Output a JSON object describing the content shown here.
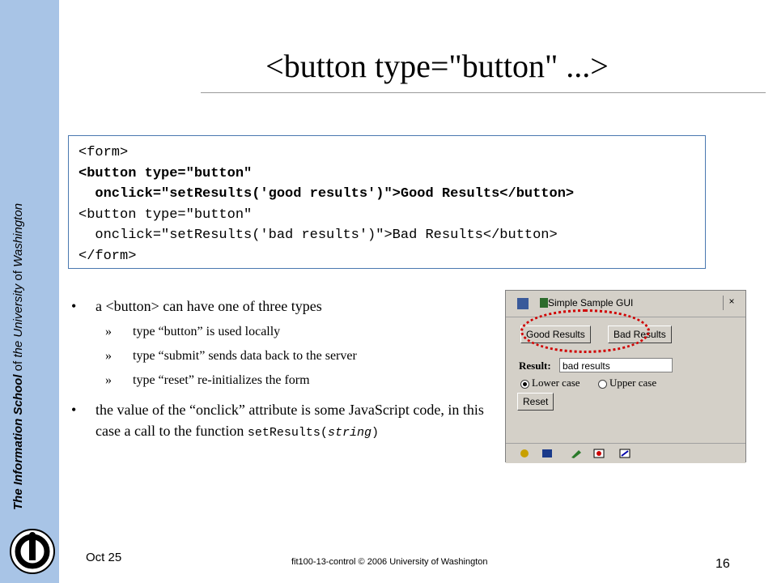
{
  "sidebar": {
    "school_bold": "The Information School",
    "of_1": " of ",
    "university": "the University",
    "of_2": " of ",
    "washington": "Washington"
  },
  "title": "<button type=\"button\" ...>",
  "code": {
    "line1": "<form>",
    "line2": "<button type=\"button\"",
    "line3": "  onclick=\"setResults('good results')\">Good Results</button>",
    "line4": "<button type=\"button\"",
    "line5": "  onclick=\"setResults('bad results')\">Bad Results</button>",
    "line6": "</form>"
  },
  "bullets": {
    "marker": "•",
    "sub_marker": "»",
    "b1": "a <button> can have one of three types",
    "sub1": "type “button” is used locally",
    "sub2": "type “submit” sends data back to the server",
    "sub3": "type “reset” re-initializes the form",
    "b2_text": "the value of the “onclick” attribute is some JavaScript code, in this case a call to the function",
    "b2_code_fn": "setResults(",
    "b2_code_arg": "string",
    "b2_code_end": ")"
  },
  "screenshot": {
    "window_title": "Simple Sample GUI",
    "close_glyph": "×",
    "good_button": "Good Results",
    "bad_button": "Bad Results",
    "result_label": "Result:",
    "result_value": "bad results",
    "radio_lower": "Lower case",
    "radio_upper": "Upper case",
    "reset_button": "Reset",
    "highlight_color": "#d00000"
  },
  "footer": {
    "date": "Oct 25",
    "center": "fit100-13-control © 2006 University of Washington",
    "page": "16"
  }
}
